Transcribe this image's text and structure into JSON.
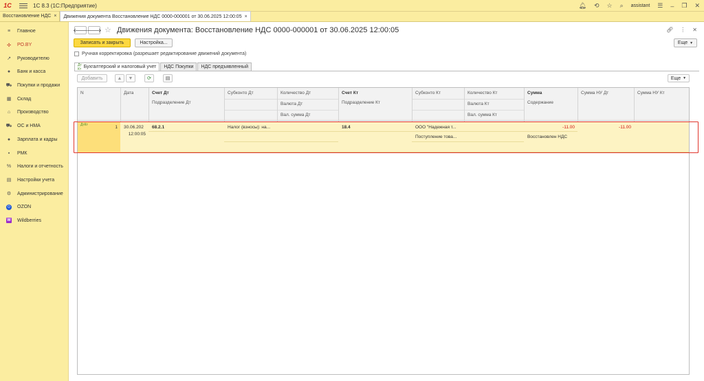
{
  "app": {
    "logo": "1С",
    "title": "1С 8.3  (1С:Предприятие)",
    "user": "assistant"
  },
  "window_tabs": [
    {
      "label": "Восстановление НДС"
    },
    {
      "label": "Движения документа  Восстановление НДС 0000-000001 от 30.06.2025 12:00:05"
    }
  ],
  "sidebar": {
    "items": [
      {
        "label": "Главное",
        "icon": "≡"
      },
      {
        "label": "РО.BY",
        "icon": "✣"
      },
      {
        "label": "Руководителю",
        "icon": "↗"
      },
      {
        "label": "Банк и касса",
        "icon": "●"
      },
      {
        "label": "Покупки и продажи",
        "icon": "⛟"
      },
      {
        "label": "Склад",
        "icon": "▦"
      },
      {
        "label": "Производство",
        "icon": "⌂"
      },
      {
        "label": "ОС и НМА",
        "icon": "⛟"
      },
      {
        "label": "Зарплата и кадры",
        "icon": "●"
      },
      {
        "label": "РМК",
        "icon": "▪"
      },
      {
        "label": "Налоги и отчетность",
        "icon": "%"
      },
      {
        "label": "Настройки учета",
        "icon": "▤"
      },
      {
        "label": "Администрирование",
        "icon": "⚙"
      },
      {
        "label": "OZON",
        "icon": "O"
      },
      {
        "label": "Wildberries",
        "icon": "W"
      }
    ]
  },
  "doc": {
    "title": "Движения документа: Восстановление НДС 0000-000001 от 30.06.2025 12:00:05",
    "save_close": "Записать и закрыть",
    "settings": "Настройка...",
    "more": "Еще",
    "manual_correction": "Ручная корректировка (разрешает редактирование движений документа)"
  },
  "form_tabs": [
    {
      "label": "Бухгалтерский и налоговый учет"
    },
    {
      "label": "НДС Покупки"
    },
    {
      "label": "НДС предъявленный"
    }
  ],
  "toolbar": {
    "add": "Добавить",
    "more": "Еще"
  },
  "grid": {
    "headers": {
      "n": "N",
      "date": "Дата",
      "account_dt": "Счет Дт",
      "division_dt": "Подразделение Дт",
      "subconto_dt": "Субконто Дт",
      "qty_dt": "Количество Дт",
      "currency_dt": "Валюта Дт",
      "cur_sum_dt": "Вал. сумма Дт",
      "account_kt": "Счет Кт",
      "division_kt": "Подразделение Кт",
      "subconto_kt": "Субконто Кт",
      "qty_kt": "Количество Кт",
      "currency_kt": "Валюта Кт",
      "cur_sum_kt": "Вал. сумма Кт",
      "sum": "Сумма",
      "content": "Содержание",
      "sum_nu_dt": "Сумма НУ Дт",
      "sum_nu_kt": "Сумма НУ Кт"
    },
    "rows": [
      {
        "n": "1",
        "icon": "ДтКт",
        "date": "30.06.202",
        "time": "12:00:05",
        "account_dt": "68.2.1",
        "subconto_dt": "Налог (взносы): на...",
        "account_kt": "18.4",
        "subconto_kt_1": "ООО \"Надежная т...",
        "subconto_kt_2": "Поступление това...",
        "sum": "-11.00",
        "content": "Восстановлен НДС",
        "sum_nu_dt": "-11.00"
      }
    ]
  }
}
